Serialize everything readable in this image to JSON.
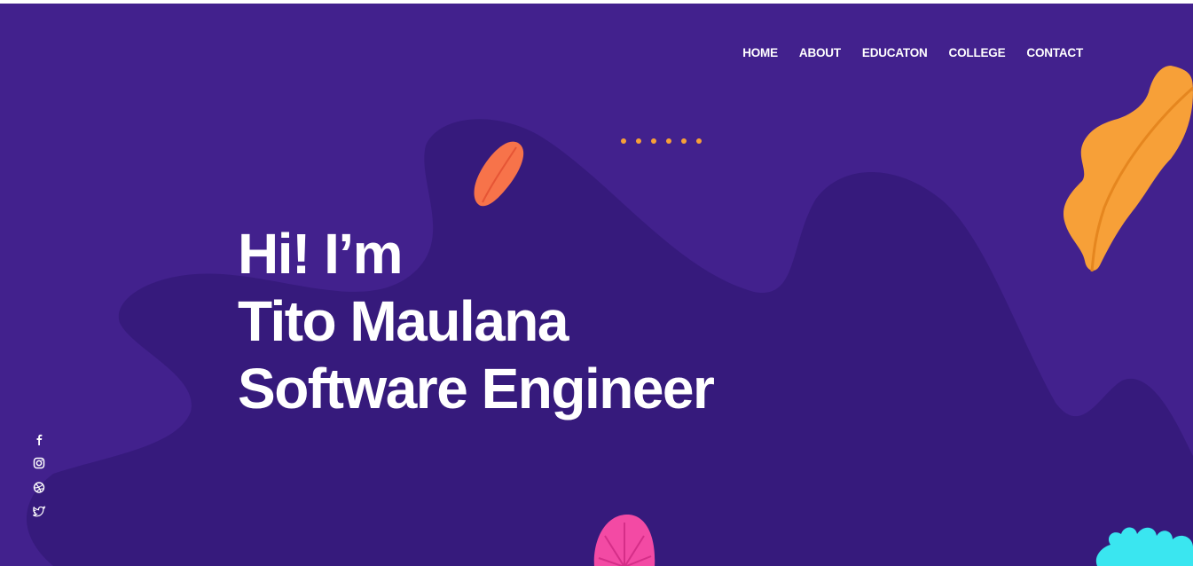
{
  "nav": {
    "items": [
      {
        "label": "HOME"
      },
      {
        "label": "ABOUT"
      },
      {
        "label": "EDUCATON"
      },
      {
        "label": "COLLEGE"
      },
      {
        "label": "CONTACT"
      }
    ]
  },
  "hero": {
    "greeting": "Hi! I’m",
    "name": "Tito Maulana",
    "role": "Software Engineer"
  },
  "social": {
    "icons": [
      "facebook-icon",
      "instagram-icon",
      "dribbble-icon",
      "twitter-icon"
    ]
  },
  "colors": {
    "background": "#42218d",
    "blob": "#361a7c",
    "accent_orange": "#f7a038",
    "leaf_red": "#f7734a",
    "flower_pink": "#f34aa4",
    "plant_cyan": "#3ae6f0",
    "text": "#ffffff"
  }
}
